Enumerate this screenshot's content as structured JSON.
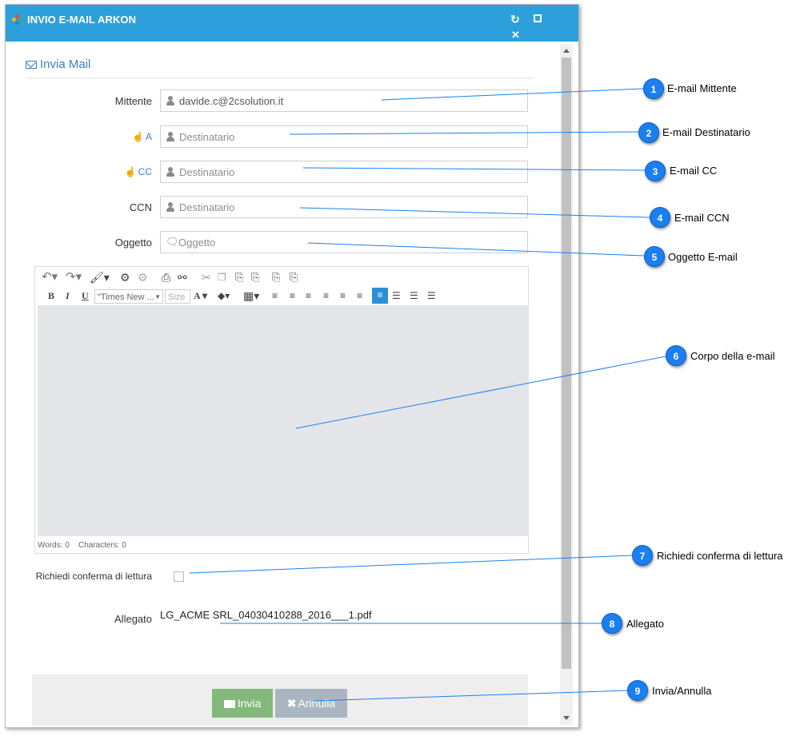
{
  "window": {
    "title": "INVIO E-MAIL ARKON",
    "refresh_icon": "refresh-icon",
    "maximize_icon": "maximize-icon",
    "close_icon": "close-icon",
    "title_bar_color": "#2da0dc"
  },
  "form": {
    "heading": "Invia Mail",
    "sender": {
      "label": "Mittente",
      "value": "davide.c@2csolution.it"
    },
    "to": {
      "label": "A",
      "placeholder": "Destinatario"
    },
    "cc": {
      "label": "CC",
      "placeholder": "Destinatario"
    },
    "bcc": {
      "label": "CCN",
      "placeholder": "Destinatario"
    },
    "subject": {
      "label": "Oggetto",
      "placeholder": "Oggetto"
    },
    "read_receipt": {
      "label": "Richiedi conferma di lettura",
      "checked": false
    },
    "attachment": {
      "label": "Allegato",
      "filename": "LG_ACME SRL_04030410288_2016___1.pdf"
    }
  },
  "editor": {
    "font_name": "\"Times New ...",
    "font_size_placeholder": "Size",
    "status_words": "Words: 0",
    "status_chars": "Characters: 0",
    "toolbar_row1_icons": [
      "undo-icon",
      "redo-icon",
      "format-painter-icon",
      "link-icon",
      "unlink-icon",
      "print-icon",
      "find-icon",
      "cut-icon",
      "copy-icon",
      "paste-icon",
      "paste-text-icon",
      "paste-word-icon",
      "paste-html-icon"
    ],
    "toolbar_row2_icons": [
      "bold-icon",
      "italic-icon",
      "underline-icon",
      "font-color-icon",
      "highlight-icon",
      "table-icon",
      "outdent-icon",
      "indent-icon",
      "align-left-icon",
      "align-center-icon",
      "align-right-icon",
      "justify-icon",
      "clear-format-icon",
      "bullet-list-icon",
      "numbered-list-icon",
      "line-height-icon"
    ]
  },
  "buttons": {
    "send": "Invia",
    "cancel": "Annulla",
    "send_color": "#84b87c",
    "cancel_color": "#a9b6c1"
  },
  "callouts": [
    {
      "num": "1",
      "text": "E-mail Mittente"
    },
    {
      "num": "2",
      "text": "E-mail Destinatario"
    },
    {
      "num": "3",
      "text": "E-mail CC"
    },
    {
      "num": "4",
      "text": "E-mail CCN"
    },
    {
      "num": "5",
      "text": "Oggetto E-mail"
    },
    {
      "num": "6",
      "text": "Corpo della e-mail"
    },
    {
      "num": "7",
      "text": "Richiedi conferma di lettura"
    },
    {
      "num": "8",
      "text": "Allegato"
    },
    {
      "num": "9",
      "text": "Invia/Annulla"
    }
  ]
}
